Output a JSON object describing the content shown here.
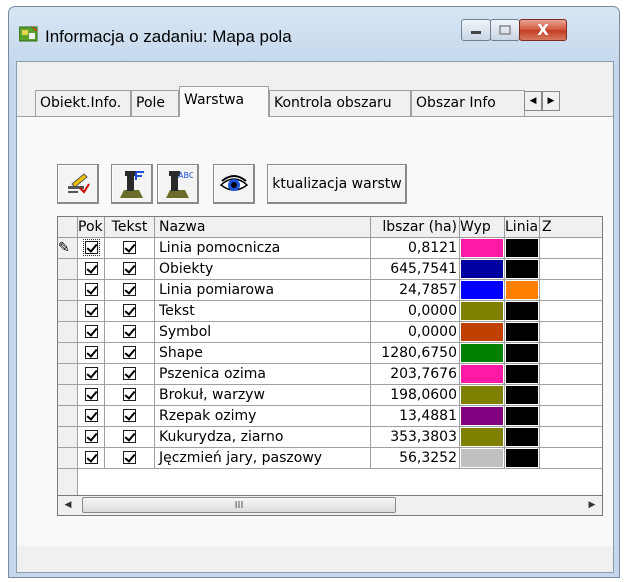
{
  "window": {
    "title": "Informacja o zadaniu: Mapa pola",
    "minimize_icon": "minimize-icon",
    "maximize_icon": "maximize-icon",
    "close_glyph": "X"
  },
  "tabs": [
    {
      "label": "Obiekt.Info.",
      "active": false
    },
    {
      "label": "Pole",
      "active": false
    },
    {
      "label": "Warstwa",
      "active": true
    },
    {
      "label": "Kontrola obszaru",
      "active": false
    },
    {
      "label": "Obszar Info",
      "active": false
    }
  ],
  "tab_scroll": {
    "left_glyph": "◀",
    "right_glyph": "▶"
  },
  "toolbar": {
    "buttons": [
      {
        "icon": "edit-layers-icon"
      },
      {
        "icon": "text-properties-icon"
      },
      {
        "icon": "label-abc-icon"
      },
      {
        "icon": "eye-icon"
      }
    ],
    "update_label": "ktualizacja warstw"
  },
  "grid": {
    "headers": {
      "pok": "Pok.",
      "tekst": "Tekst",
      "nazwa": "Nazwa",
      "obszar": "lbszar (ha)",
      "wyp": "Wyp",
      "linia": "Linia",
      "z": "Z"
    },
    "rows": [
      {
        "pok": true,
        "tekst": true,
        "nazwa": "Linia pomocnicza",
        "obszar": "0,8121",
        "fill": "#ff1aa6",
        "line": "#000000"
      },
      {
        "pok": true,
        "tekst": true,
        "nazwa": "Obiekty",
        "obszar": "645,7541",
        "fill": "#0000a0",
        "line": "#000000"
      },
      {
        "pok": true,
        "tekst": true,
        "nazwa": "Linia pomiarowa",
        "obszar": "24,7857",
        "fill": "#0000ff",
        "line": "#ff8000"
      },
      {
        "pok": true,
        "tekst": true,
        "nazwa": "Tekst",
        "obszar": "0,0000",
        "fill": "#808000",
        "line": "#000000"
      },
      {
        "pok": true,
        "tekst": true,
        "nazwa": "Symbol",
        "obszar": "0,0000",
        "fill": "#c04000",
        "line": "#000000"
      },
      {
        "pok": true,
        "tekst": true,
        "nazwa": "Shape",
        "obszar": "1280,6750",
        "fill": "#008000",
        "line": "#000000"
      },
      {
        "pok": true,
        "tekst": true,
        "nazwa": "Pszenica ozima",
        "obszar": "203,7676",
        "fill": "#ff1aa6",
        "line": "#000000"
      },
      {
        "pok": true,
        "tekst": true,
        "nazwa": "Brokuł, warzyw",
        "obszar": "198,0600",
        "fill": "#808000",
        "line": "#000000"
      },
      {
        "pok": true,
        "tekst": true,
        "nazwa": "Rzepak ozimy",
        "obszar": "13,4881",
        "fill": "#800080",
        "line": "#000000"
      },
      {
        "pok": true,
        "tekst": true,
        "nazwa": "Kukurydza, ziarno",
        "obszar": "353,3803",
        "fill": "#808000",
        "line": "#000000"
      },
      {
        "pok": true,
        "tekst": true,
        "nazwa": "Jęczmień jary, paszowy",
        "obszar": "56,3252",
        "fill": "#c0c0c0",
        "line": "#000000"
      }
    ],
    "edit_indicator_glyph": "✎"
  },
  "hscroll": {
    "left_glyph": "◀",
    "right_glyph": "▶",
    "thumb_grip": "III"
  }
}
